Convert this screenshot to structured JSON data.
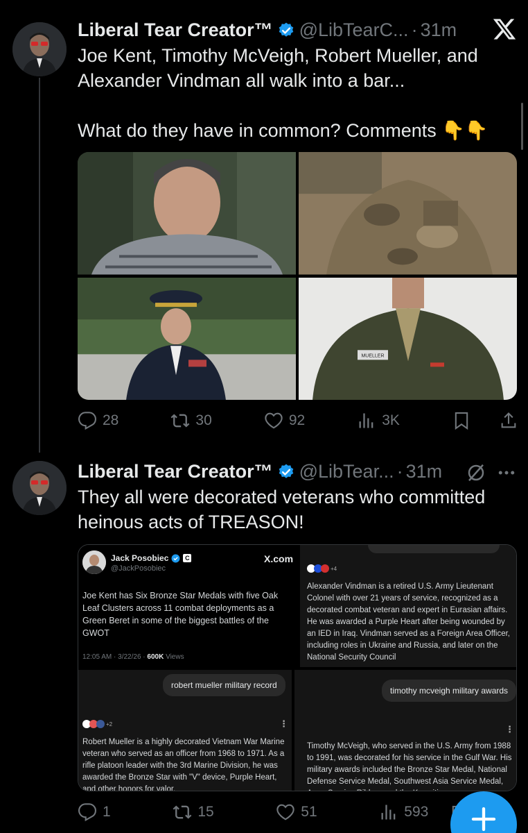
{
  "tweet1": {
    "author_name": "Liberal Tear Creator™",
    "handle": "@LibTearC...",
    "time": "31m",
    "line1": "Joe Kent, Timothy McVeigh, Robert Mueller, and Alexander Vindman all walk into a bar...",
    "line2": "What do they have in common? Comments 👇👇",
    "stats": {
      "replies": "28",
      "reposts": "30",
      "likes": "92",
      "views": "3K"
    },
    "photos": [
      {
        "icon": "photo-man-plaid-shirt"
      },
      {
        "icon": "photo-soldier-desert-camo"
      },
      {
        "icon": "photo-army-officer-dress-uniform"
      },
      {
        "icon": "photo-marine-uniform-mueller",
        "name_tag": "MUELLER"
      }
    ]
  },
  "tweet2": {
    "author_name": "Liberal Tear Creator™",
    "handle": "@LibTear...",
    "time": "31m",
    "text": "They all were decorated veterans who committed heinous acts of TREASON!",
    "stats": {
      "replies": "1",
      "reposts": "15",
      "likes": "51",
      "views": "593"
    }
  },
  "embed": {
    "top_left": {
      "name": "Jack Posobiec",
      "handle": "@JackPosobiec",
      "site": "X.com",
      "text": "Joe Kent has Six Bronze Star Medals with five Oak Leaf Clusters across 11 combat deployments as a Green Beret in some of the biggest battles of the GWOT",
      "meta_time": "12:05 AM · 3/22/26 · ",
      "meta_views": "600K",
      "meta_views_label": " Views"
    },
    "top_right": {
      "sources_count": "+4",
      "text": "Alexander Vindman is a retired U.S. Army Lieutenant Colonel with over 21 years of service, recognized as a decorated combat veteran and expert in Eurasian affairs. He was awarded a Purple Heart after being wounded by an IED in Iraq. Vindman served as a Foreign Area Officer, including roles in Ukraine and Russia, and later on the National Security Council"
    },
    "bottom_left": {
      "query": "robert mueller military record",
      "sources_count": "+2",
      "text": "Robert Mueller is a highly decorated Vietnam War Marine veteran who served as an officer from 1968 to 1971. As a rifle platoon leader with the 3rd Marine Division, he was awarded the Bronze Star with \"V\" device, Purple Heart, and other honors for valor."
    },
    "bottom_right": {
      "query": "timothy mcveigh military awards",
      "text": "Timothy McVeigh, who served in the U.S. Army from 1988 to 1991, was decorated for his service in the Gulf War. His military awards included the Bronze Star Medal, National Defense Service Medal, Southwest Asia Service Medal, Army Service Ribbon and the Kuwaiti"
    }
  },
  "colors": {
    "accent": "#1d9bf0",
    "muted": "#71767b",
    "text": "#e7e9ea",
    "background": "#000000",
    "divider": "#333639"
  }
}
